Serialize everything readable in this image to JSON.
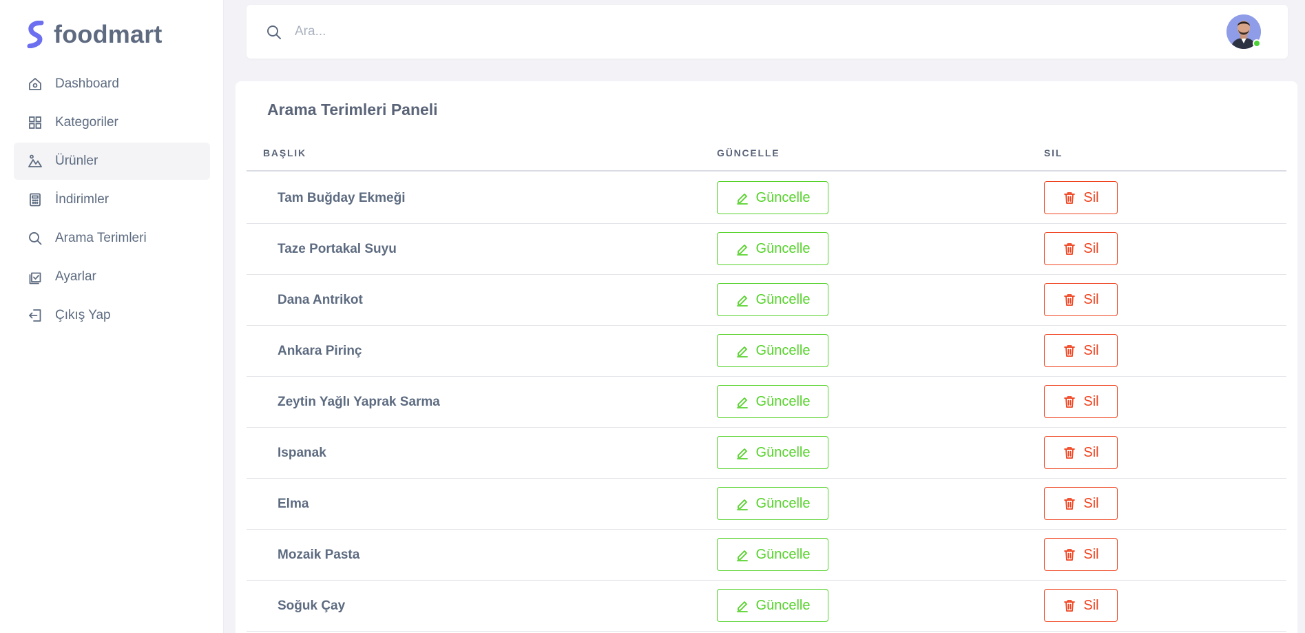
{
  "brand": {
    "name": "foodmart",
    "accent": "#6c6ff0"
  },
  "sidebar": {
    "items": [
      {
        "label": "Dashboard",
        "icon": "home-icon",
        "active": false
      },
      {
        "label": "Kategoriler",
        "icon": "grid-icon",
        "active": false
      },
      {
        "label": "Ürünler",
        "icon": "image-icon",
        "active": true
      },
      {
        "label": "İndirimler",
        "icon": "calculator-icon",
        "active": false
      },
      {
        "label": "Arama Terimleri",
        "icon": "search-icon",
        "active": false
      },
      {
        "label": "Ayarlar",
        "icon": "checkbox-icon",
        "active": false
      },
      {
        "label": "Çıkış Yap",
        "icon": "logout-icon",
        "active": false
      }
    ]
  },
  "search": {
    "placeholder": "Ara..."
  },
  "panel": {
    "title": "Arama Terimleri Paneli",
    "columns": {
      "title": "BAŞLIK",
      "update": "GÜNCELLE",
      "delete": "SIL"
    },
    "rows": [
      {
        "title": "Tam Buğday Ekmeği",
        "update_label": "Güncelle",
        "delete_label": "Sil"
      },
      {
        "title": "Taze Portakal Suyu",
        "update_label": "Güncelle",
        "delete_label": "Sil"
      },
      {
        "title": "Dana Antrikot",
        "update_label": "Güncelle",
        "delete_label": "Sil"
      },
      {
        "title": "Ankara Pirinç",
        "update_label": "Güncelle",
        "delete_label": "Sil"
      },
      {
        "title": "Zeytin Yağlı Yaprak Sarma",
        "update_label": "Güncelle",
        "delete_label": "Sil"
      },
      {
        "title": "Ispanak",
        "update_label": "Güncelle",
        "delete_label": "Sil"
      },
      {
        "title": "Elma",
        "update_label": "Güncelle",
        "delete_label": "Sil"
      },
      {
        "title": "Mozaik Pasta",
        "update_label": "Güncelle",
        "delete_label": "Sil"
      },
      {
        "title": "Soğuk Çay",
        "update_label": "Güncelle",
        "delete_label": "Sil"
      }
    ]
  },
  "colors": {
    "update": "#55d22a",
    "delete": "#f0431f",
    "online": "#4cd137"
  }
}
